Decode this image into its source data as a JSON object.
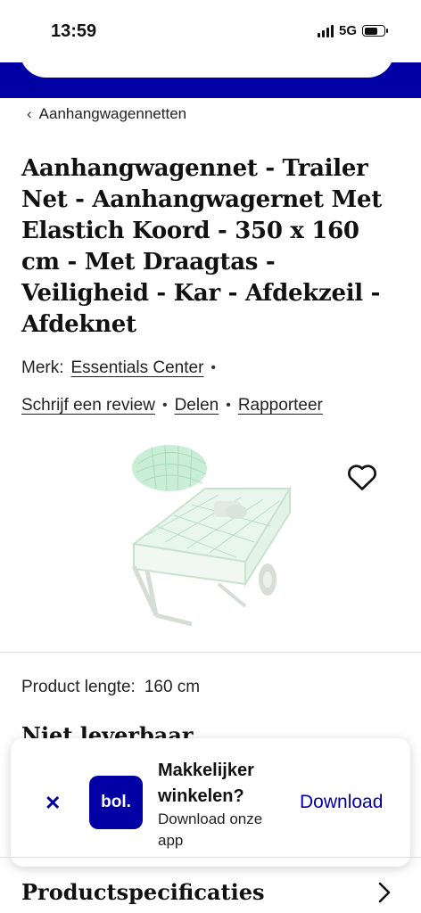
{
  "status_bar": {
    "time": "13:59",
    "network": "5G"
  },
  "breadcrumb": {
    "label": "Aanhangwagennetten"
  },
  "product": {
    "title": "Aanhangwagennet - Trailer Net - Aanhangwagernet Met Elastich Koord - 350 x 160 cm - Met Draagtas - Veiligheid - Kar - Afdekzeil - Afdeknet",
    "brand_label": "Merk:",
    "brand": "Essentials Center",
    "review_link": "Schrijf een review",
    "share_link": "Delen",
    "report_link": "Rapporteer",
    "spec_label": "Product lengte:",
    "spec_value": "160 cm",
    "availability": "Niet leverbaar"
  },
  "app_banner": {
    "logo_text": "bol.",
    "title": "Makkelijker winkelen?",
    "subtitle": "Download onze app",
    "download_label": "Download"
  },
  "sections": {
    "specs_title": "Productspecificaties"
  },
  "colors": {
    "brand_blue": "#0000a4",
    "net_green": "#7fd4a0"
  },
  "icons": {
    "back": "chevron-left-icon",
    "favorite": "heart-icon",
    "close": "close-icon",
    "section": "chevron-right-icon"
  }
}
